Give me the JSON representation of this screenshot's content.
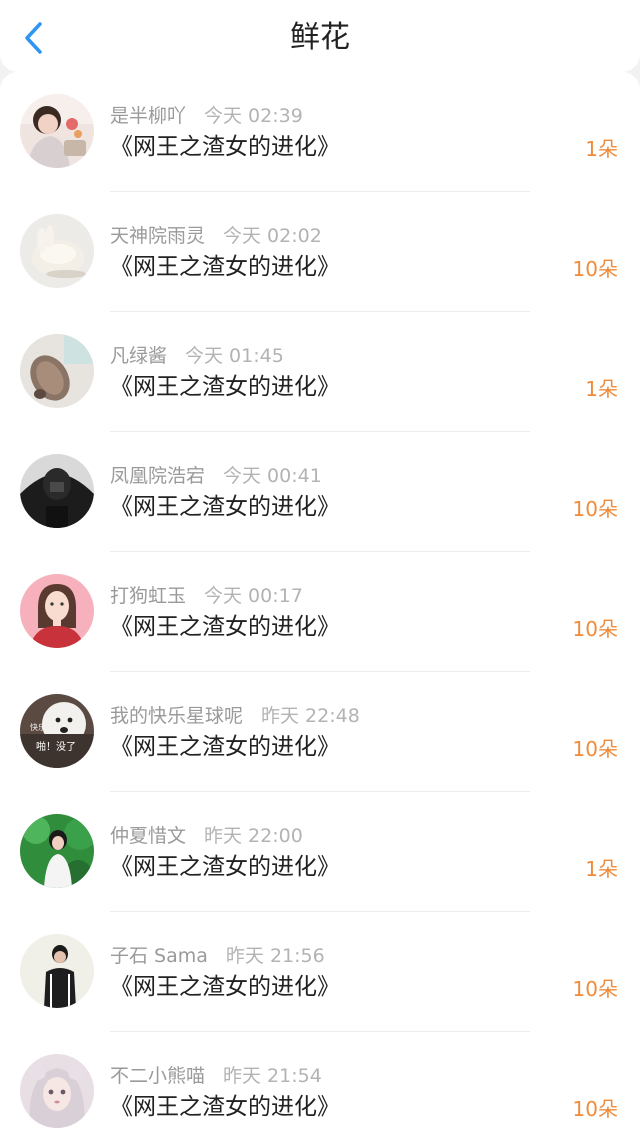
{
  "header": {
    "title": "鲜花",
    "back_icon": "chevron-left-icon",
    "accent_color": "#2f95f3"
  },
  "colors": {
    "count": "#ef8b3b",
    "name": "#9a9a9a",
    "book": "#222222"
  },
  "items": [
    {
      "user": "是半柳吖",
      "time": "今天 02:39",
      "book": "《网王之渣女的进化》",
      "count": "1朵"
    },
    {
      "user": "天神院雨灵",
      "time": "今天 02:02",
      "book": "《网王之渣女的进化》",
      "count": "10朵"
    },
    {
      "user": "凡绿酱",
      "time": "今天 01:45",
      "book": "《网王之渣女的进化》",
      "count": "1朵"
    },
    {
      "user": "凤凰院浩宕",
      "time": "今天 00:41",
      "book": "《网王之渣女的进化》",
      "count": "10朵"
    },
    {
      "user": "打狗虹玉",
      "time": "今天 00:17",
      "book": "《网王之渣女的进化》",
      "count": "10朵"
    },
    {
      "user": "我的快乐星球呢",
      "time": "昨天 22:48",
      "book": "《网王之渣女的进化》",
      "count": "10朵",
      "avatar_text": [
        "快乐",
        "啪！没了"
      ]
    },
    {
      "user": "仲夏惜文",
      "time": "昨天 22:00",
      "book": "《网王之渣女的进化》",
      "count": "1朵"
    },
    {
      "user": "子石 Sama",
      "time": "昨天 21:56",
      "book": "《网王之渣女的进化》",
      "count": "10朵"
    },
    {
      "user": "不二小熊喵",
      "time": "昨天 21:54",
      "book": "《网王之渣女的进化》",
      "count": "10朵"
    }
  ]
}
